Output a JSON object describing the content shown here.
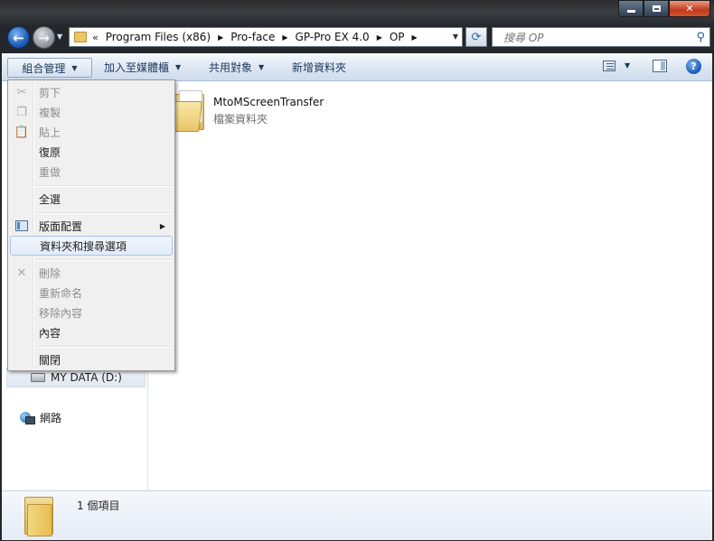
{
  "window": {
    "caption_buttons": [
      "minimize",
      "maximize",
      "close"
    ]
  },
  "nav": {
    "back_icon": "back-arrow-icon",
    "forward_icon": "forward-arrow-icon",
    "breadcrumb_prefix": "«",
    "breadcrumb": [
      "Program Files (x86)",
      "Pro-face",
      "GP-Pro EX 4.0",
      "OP"
    ],
    "search_placeholder": "搜尋 OP"
  },
  "toolbar": {
    "organize": "組合管理",
    "add_to_library": "加入至媒體櫃",
    "share_with": "共用對象",
    "new_folder": "新增資料夾"
  },
  "organize_menu": {
    "items": [
      {
        "label": "剪下",
        "enabled": false,
        "icon": "cut-icon"
      },
      {
        "label": "複製",
        "enabled": false,
        "icon": "copy-icon"
      },
      {
        "label": "貼上",
        "enabled": false,
        "icon": "paste-icon"
      },
      {
        "label": "復原",
        "enabled": true
      },
      {
        "label": "重做",
        "enabled": false
      },
      {
        "label": "全選",
        "enabled": true
      },
      {
        "label": "版面配置",
        "enabled": true,
        "icon": "layout-icon",
        "submenu": true
      },
      {
        "label": "資料夾和搜尋選項",
        "enabled": true,
        "highlighted": true
      },
      {
        "label": "刪除",
        "enabled": false,
        "icon": "delete-icon"
      },
      {
        "label": "重新命名",
        "enabled": false
      },
      {
        "label": "移除內容",
        "enabled": false
      },
      {
        "label": "內容",
        "enabled": true
      },
      {
        "label": "關閉",
        "enabled": true
      }
    ]
  },
  "nav_pane": {
    "drive": "MY DATA (D:)",
    "network": "網路"
  },
  "files": [
    {
      "name": "MtoMScreenTransfer",
      "type": "檔案資料夾"
    }
  ],
  "details": {
    "count_text": "1 個項目"
  }
}
